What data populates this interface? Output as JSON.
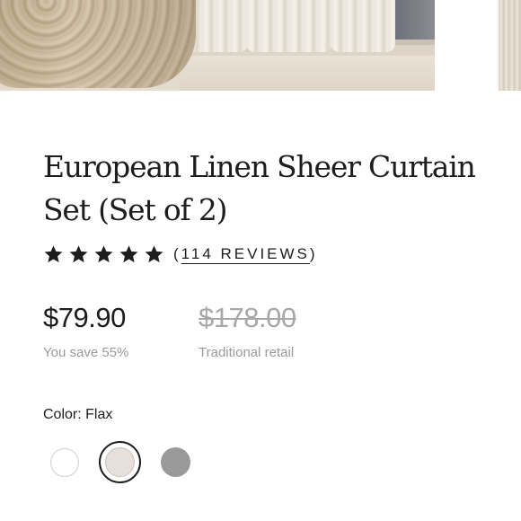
{
  "product": {
    "title": "European Linen Sheer Curtain Set (Set of 2)",
    "rating": {
      "stars": 5,
      "reviews_text": "114 REVIEWS"
    },
    "price": "$79.90",
    "savings": "You save 55%",
    "retail_price": "$178.00",
    "retail_label": "Traditional retail"
  },
  "color": {
    "label_prefix": "Color:",
    "selected": "Flax",
    "swatches": [
      {
        "name": "white",
        "hex": "#ffffff"
      },
      {
        "name": "flax",
        "hex": "#e7dfdc",
        "selected": true
      },
      {
        "name": "grey",
        "hex": "#999999"
      }
    ]
  },
  "icons": {
    "rating_star": "star-icon"
  }
}
